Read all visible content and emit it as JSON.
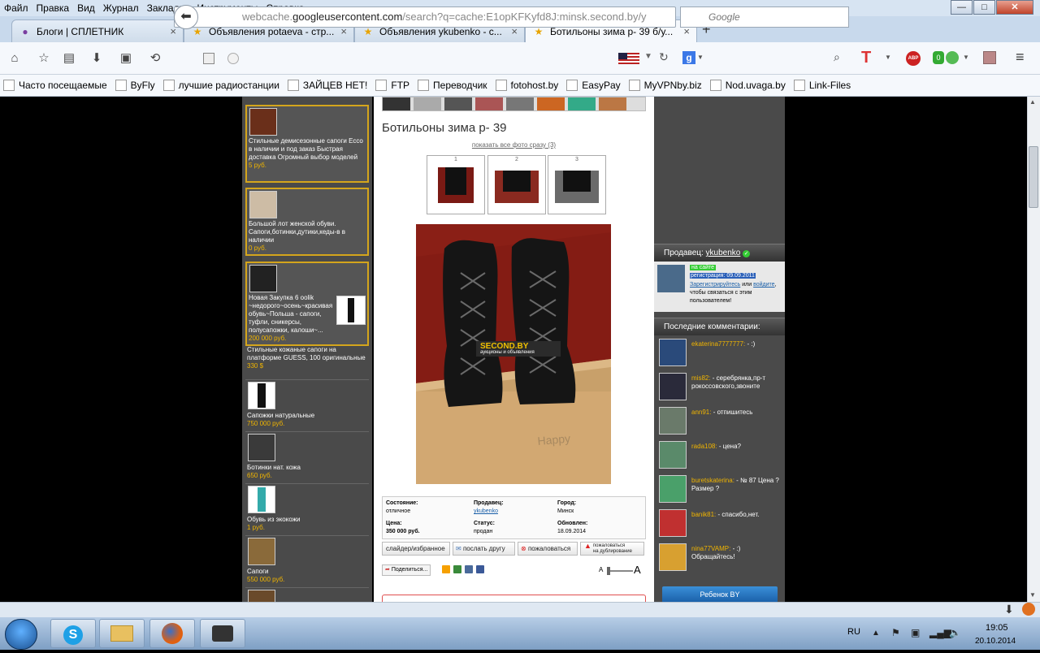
{
  "menu": {
    "items": [
      "Файл",
      "Правка",
      "Вид",
      "Журнал",
      "Закладки",
      "Инструменты",
      "Справка"
    ]
  },
  "window_controls": {
    "minimize": "—",
    "maximize": "□",
    "close": "✕"
  },
  "tabs": [
    {
      "label": "Блоги | СПЛЕТНИК",
      "icon": "globe-icon"
    },
    {
      "label": "Объявления potaeva - стр...",
      "icon": "star-icon"
    },
    {
      "label": "Объявления ykubenko - с...",
      "icon": "star-icon"
    },
    {
      "label": "Ботильоны зима р- 39 б/у...",
      "icon": "star-icon",
      "active": true
    }
  ],
  "tab_close": "×",
  "new_tab": "+",
  "nav": {
    "back": "⬅",
    "url_prefix": "webcache.",
    "url_domain": "googleusercontent.com",
    "url_rest": "/search?q=cache:E1opKFKyfd8J:minsk.second.by/y",
    "search_placeholder": "Google",
    "search_engine_letter": "g"
  },
  "bookmarks": [
    {
      "label": "Часто посещаемые"
    },
    {
      "label": "ByFly"
    },
    {
      "label": "лучшие радиостанции"
    },
    {
      "label": "ЗАЙЦЕВ НЕТ!"
    },
    {
      "label": "FTP"
    },
    {
      "label": "Переводчик"
    },
    {
      "label": "fotohost.by"
    },
    {
      "label": "EasyPay"
    },
    {
      "label": "MyVPNby.biz"
    },
    {
      "label": "Nod.uvaga.by"
    },
    {
      "label": "Link-Files"
    }
  ],
  "left_ads": [
    {
      "text": "Стильные демисезонные сапоги Ecco в наличии и под заказ Быстрая доставка Огромный выбор моделей",
      "price": "5 руб."
    },
    {
      "text": "Большой лот женской обуви. Сапоги,ботинки,дутики,кеды-в в наличии",
      "price": "0 руб."
    },
    {
      "text": "Новая Закупка 6 oolik ~недорого~осень~красивая обувь~Польша - сапоги, туфли, сникерсы, полусапожки, калоши~...",
      "price": "200 000 руб."
    },
    {
      "text": "Стильные кожаные сапоги на платформе GUESS, 100 оригинальные",
      "price": "330 $"
    },
    {
      "text": "Сапожки натуральные",
      "price": "750 000 руб."
    },
    {
      "text": "Ботинки нат. кожа",
      "price": "650 руб."
    },
    {
      "text": "Обувь из экокожи",
      "price": "1 руб."
    },
    {
      "text": "Сапоги",
      "price": "550 000 руб."
    }
  ],
  "listing": {
    "title": "Ботильоны зима р- 39",
    "all_photos": "показать все фото сразу (3)",
    "thumbs": [
      "1",
      "2",
      "3"
    ],
    "watermark_brand": "SECOND.BY",
    "watermark_tag": "аукционы и объявления",
    "info": {
      "condition_label": "Состояние:",
      "condition": "отличное",
      "seller_label": "Продавец:",
      "seller": "ykubenko",
      "city_label": "Город:",
      "city": "Минск",
      "price_label": "Цена:",
      "price": "350 000 руб.",
      "status_label": "Статус:",
      "status": "продан",
      "updated_label": "Обновлен:",
      "updated": "18.09.2014"
    },
    "actions": {
      "slider": "слайдер/избранное",
      "send_friend": "послать другу",
      "complain": "пожаловаться",
      "complain_dup_1": "пожаловаться",
      "complain_dup_2": "на дублирование"
    },
    "share": "Поделиться...",
    "font_small": "A",
    "font_large": "A"
  },
  "sidebar_right": {
    "seller_head": "Продавец:",
    "seller_name": "ykubenko",
    "online": "на сайте",
    "registered": "регистрация: 09.09.2011",
    "register_link": "Зарегистрируйтесь",
    "or": "или",
    "login_link": "войдите",
    "contact_text": ", чтобы связаться с этим пользователем!",
    "comments_head": "Последние комментарии:",
    "comments": [
      {
        "user": "ekaterina7777777:",
        "text": "- :)"
      },
      {
        "user": "mis82:",
        "text": "- серебрянка,пр-т рокоссовского,звоните"
      },
      {
        "user": "ann91:",
        "text": "- отпишитесь"
      },
      {
        "user": "rada108:",
        "text": "- цена?"
      },
      {
        "user": "buretskaterina:",
        "text": "- № 87 Цена ? Размер ?"
      },
      {
        "user": "banik81:",
        "text": "- спасибо,нет."
      },
      {
        "user": "nina77VAMP:",
        "text": "- :) Обращайтесь!"
      }
    ],
    "rebenok": "Ребенок BY"
  },
  "taskbar": {
    "lang": "RU",
    "time": "19:05",
    "date": "20.10.2014"
  },
  "colors": {
    "accent_gold": "#d4a51c",
    "price_orange": "#f0b400",
    "panel_gray": "#4a4a4a"
  }
}
